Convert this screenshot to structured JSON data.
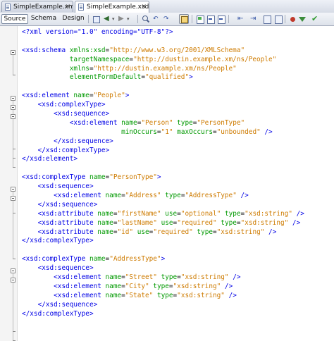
{
  "tabs": [
    {
      "label": "SimpleExample.xml",
      "active": false
    },
    {
      "label": "SimpleExample.xsd",
      "active": true
    }
  ],
  "view_buttons": {
    "source": "Source",
    "schema": "Schema",
    "design": "Design"
  },
  "toolbar_icons": [
    "go-to-source-icon",
    "back-icon",
    "forward-icon",
    "search-icon",
    "find-previous-icon",
    "find-next-icon",
    "toggle-highlight-icon",
    "toggle-bookmark-icon",
    "previous-bookmark-icon",
    "next-bookmark-icon",
    "shift-left-icon",
    "shift-right-icon",
    "comment-icon",
    "record-macro-icon",
    "stop-macro-icon",
    "check-xml-icon",
    "validate-xml-icon"
  ],
  "code_lines": [
    [
      [
        "pi",
        "<?xml version=\"1.0\" encoding=\"UTF-8\"?>"
      ]
    ],
    [],
    [
      [
        "tag",
        "<xsd:schema "
      ],
      [
        "attr",
        "xmlns:xsd"
      ],
      [
        "",
        "="
      ],
      [
        "val",
        "\"http://www.w3.org/2001/XMLSchema\""
      ]
    ],
    [
      [
        "",
        "            "
      ],
      [
        "attr",
        "targetNamespace"
      ],
      [
        "",
        "="
      ],
      [
        "val",
        "\"http://dustin.example.xm/ns/People\""
      ]
    ],
    [
      [
        "",
        "            "
      ],
      [
        "attr",
        "xmlns"
      ],
      [
        "",
        "="
      ],
      [
        "val",
        "\"http://dustin.example.xm/ns/People\""
      ]
    ],
    [
      [
        "",
        "            "
      ],
      [
        "attr",
        "elementFormDefault"
      ],
      [
        "",
        "="
      ],
      [
        "val",
        "\"qualified\""
      ],
      [
        "tag",
        ">"
      ]
    ],
    [],
    [
      [
        "tag",
        "<xsd:element "
      ],
      [
        "attr",
        "name"
      ],
      [
        "",
        "="
      ],
      [
        "val",
        "\"People\""
      ],
      [
        "tag",
        ">"
      ]
    ],
    [
      [
        "",
        "    "
      ],
      [
        "tag",
        "<xsd:complexType>"
      ]
    ],
    [
      [
        "",
        "        "
      ],
      [
        "tag",
        "<xsd:sequence>"
      ]
    ],
    [
      [
        "",
        "            "
      ],
      [
        "tag",
        "<xsd:element "
      ],
      [
        "attr",
        "name"
      ],
      [
        "",
        "="
      ],
      [
        "val",
        "\"Person\""
      ],
      [
        "",
        " "
      ],
      [
        "attr",
        "type"
      ],
      [
        "",
        "="
      ],
      [
        "val",
        "\"PersonType\""
      ]
    ],
    [
      [
        "",
        "                         "
      ],
      [
        "attr",
        "minOccurs"
      ],
      [
        "",
        "="
      ],
      [
        "val",
        "\"1\""
      ],
      [
        "",
        " "
      ],
      [
        "attr",
        "maxOccurs"
      ],
      [
        "",
        "="
      ],
      [
        "val",
        "\"unbounded\""
      ],
      [
        "",
        " "
      ],
      [
        "tag",
        "/>"
      ]
    ],
    [
      [
        "",
        "        "
      ],
      [
        "tag",
        "</xsd:sequence>"
      ]
    ],
    [
      [
        "",
        "    "
      ],
      [
        "tag",
        "</xsd:complexType>"
      ]
    ],
    [
      [
        "tag",
        "</xsd:element>"
      ]
    ],
    [],
    [
      [
        "tag",
        "<xsd:complexType "
      ],
      [
        "attr",
        "name"
      ],
      [
        "",
        "="
      ],
      [
        "val",
        "\"PersonType\""
      ],
      [
        "tag",
        ">"
      ]
    ],
    [
      [
        "",
        "    "
      ],
      [
        "tag",
        "<xsd:sequence>"
      ]
    ],
    [
      [
        "",
        "        "
      ],
      [
        "tag",
        "<xsd:element "
      ],
      [
        "attr",
        "name"
      ],
      [
        "",
        "="
      ],
      [
        "val",
        "\"Address\""
      ],
      [
        "",
        " "
      ],
      [
        "attr",
        "type"
      ],
      [
        "",
        "="
      ],
      [
        "val",
        "\"AddressType\""
      ],
      [
        "",
        " "
      ],
      [
        "tag",
        "/>"
      ]
    ],
    [
      [
        "",
        "    "
      ],
      [
        "tag",
        "</xsd:sequence>"
      ]
    ],
    [
      [
        "",
        "    "
      ],
      [
        "tag",
        "<xsd:attribute "
      ],
      [
        "attr",
        "name"
      ],
      [
        "",
        "="
      ],
      [
        "val",
        "\"firstName\""
      ],
      [
        "",
        " "
      ],
      [
        "attr",
        "use"
      ],
      [
        "",
        "="
      ],
      [
        "val",
        "\"optional\""
      ],
      [
        "",
        " "
      ],
      [
        "attr",
        "type"
      ],
      [
        "",
        "="
      ],
      [
        "val",
        "\"xsd:string\""
      ],
      [
        "",
        " "
      ],
      [
        "tag",
        "/>"
      ]
    ],
    [
      [
        "",
        "    "
      ],
      [
        "tag",
        "<xsd:attribute "
      ],
      [
        "attr",
        "name"
      ],
      [
        "",
        "="
      ],
      [
        "val",
        "\"lastName\""
      ],
      [
        "",
        " "
      ],
      [
        "attr",
        "use"
      ],
      [
        "",
        "="
      ],
      [
        "val",
        "\"required\""
      ],
      [
        "",
        " "
      ],
      [
        "attr",
        "type"
      ],
      [
        "",
        "="
      ],
      [
        "val",
        "\"xsd:string\""
      ],
      [
        "",
        " "
      ],
      [
        "tag",
        "/>"
      ]
    ],
    [
      [
        "",
        "    "
      ],
      [
        "tag",
        "<xsd:attribute "
      ],
      [
        "attr",
        "name"
      ],
      [
        "",
        "="
      ],
      [
        "val",
        "\"id\""
      ],
      [
        "",
        " "
      ],
      [
        "attr",
        "use"
      ],
      [
        "",
        "="
      ],
      [
        "val",
        "\"required\""
      ],
      [
        "",
        " "
      ],
      [
        "attr",
        "type"
      ],
      [
        "",
        "="
      ],
      [
        "val",
        "\"xsd:string\""
      ],
      [
        "",
        " "
      ],
      [
        "tag",
        "/>"
      ]
    ],
    [
      [
        "tag",
        "</xsd:complexType>"
      ]
    ],
    [],
    [
      [
        "tag",
        "<xsd:complexType "
      ],
      [
        "attr",
        "name"
      ],
      [
        "",
        "="
      ],
      [
        "val",
        "\"AddressType\""
      ],
      [
        "tag",
        ">"
      ]
    ],
    [
      [
        "",
        "    "
      ],
      [
        "tag",
        "<xsd:sequence>"
      ]
    ],
    [
      [
        "",
        "        "
      ],
      [
        "tag",
        "<xsd:element "
      ],
      [
        "attr",
        "name"
      ],
      [
        "",
        "="
      ],
      [
        "val",
        "\"Street\""
      ],
      [
        "",
        " "
      ],
      [
        "attr",
        "type"
      ],
      [
        "",
        "="
      ],
      [
        "val",
        "\"xsd:string\""
      ],
      [
        "",
        " "
      ],
      [
        "tag",
        "/>"
      ]
    ],
    [
      [
        "",
        "        "
      ],
      [
        "tag",
        "<xsd:element "
      ],
      [
        "attr",
        "name"
      ],
      [
        "",
        "="
      ],
      [
        "val",
        "\"City\""
      ],
      [
        "",
        " "
      ],
      [
        "attr",
        "type"
      ],
      [
        "",
        "="
      ],
      [
        "val",
        "\"xsd:string\""
      ],
      [
        "",
        " "
      ],
      [
        "tag",
        "/>"
      ]
    ],
    [
      [
        "",
        "        "
      ],
      [
        "tag",
        "<xsd:element "
      ],
      [
        "attr",
        "name"
      ],
      [
        "",
        "="
      ],
      [
        "val",
        "\"State\""
      ],
      [
        "",
        " "
      ],
      [
        "attr",
        "type"
      ],
      [
        "",
        "="
      ],
      [
        "val",
        "\"xsd:string\""
      ],
      [
        "",
        " "
      ],
      [
        "tag",
        "/>"
      ]
    ],
    [
      [
        "",
        "    "
      ],
      [
        "tag",
        "</xsd:sequence>"
      ]
    ],
    [
      [
        "tag",
        "</xsd:complexType>"
      ]
    ]
  ],
  "colors": {
    "tag": "#0000e6",
    "attr": "#009900",
    "value": "#ce7b00",
    "text": "#000000"
  }
}
